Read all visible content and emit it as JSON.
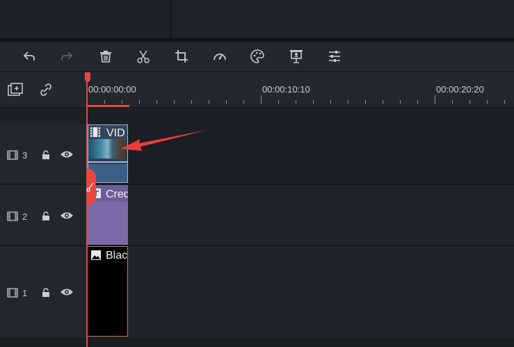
{
  "toolbar": {
    "buttons": [
      {
        "name": "undo-button",
        "icon": "undo-icon"
      },
      {
        "name": "redo-button",
        "icon": "redo-icon"
      },
      {
        "name": "delete-button",
        "icon": "trash-icon"
      },
      {
        "name": "cut-button",
        "icon": "scissors-icon"
      },
      {
        "name": "crop-button",
        "icon": "crop-icon"
      },
      {
        "name": "speed-button",
        "icon": "speedometer-icon"
      },
      {
        "name": "color-button",
        "icon": "palette-icon"
      },
      {
        "name": "green-screen-button",
        "icon": "presentation-icon"
      },
      {
        "name": "adjust-button",
        "icon": "sliders-icon"
      }
    ]
  },
  "timeline": {
    "timecodes": [
      "00:00:00:00",
      "00:00:10:10",
      "00:00:20:20"
    ]
  },
  "tracks": [
    {
      "number": "3",
      "clip_title": "VID",
      "clip_type": "video"
    },
    {
      "number": "2",
      "clip_title": "Cred",
      "clip_type": "title"
    },
    {
      "number": "1",
      "clip_title": "Blac",
      "clip_type": "image"
    }
  ],
  "colors": {
    "accent": "#e9473e",
    "background": "#1f232a",
    "clip_video": "#3d5f86",
    "clip_title": "#7b68a6",
    "clip_black": "#000000"
  }
}
